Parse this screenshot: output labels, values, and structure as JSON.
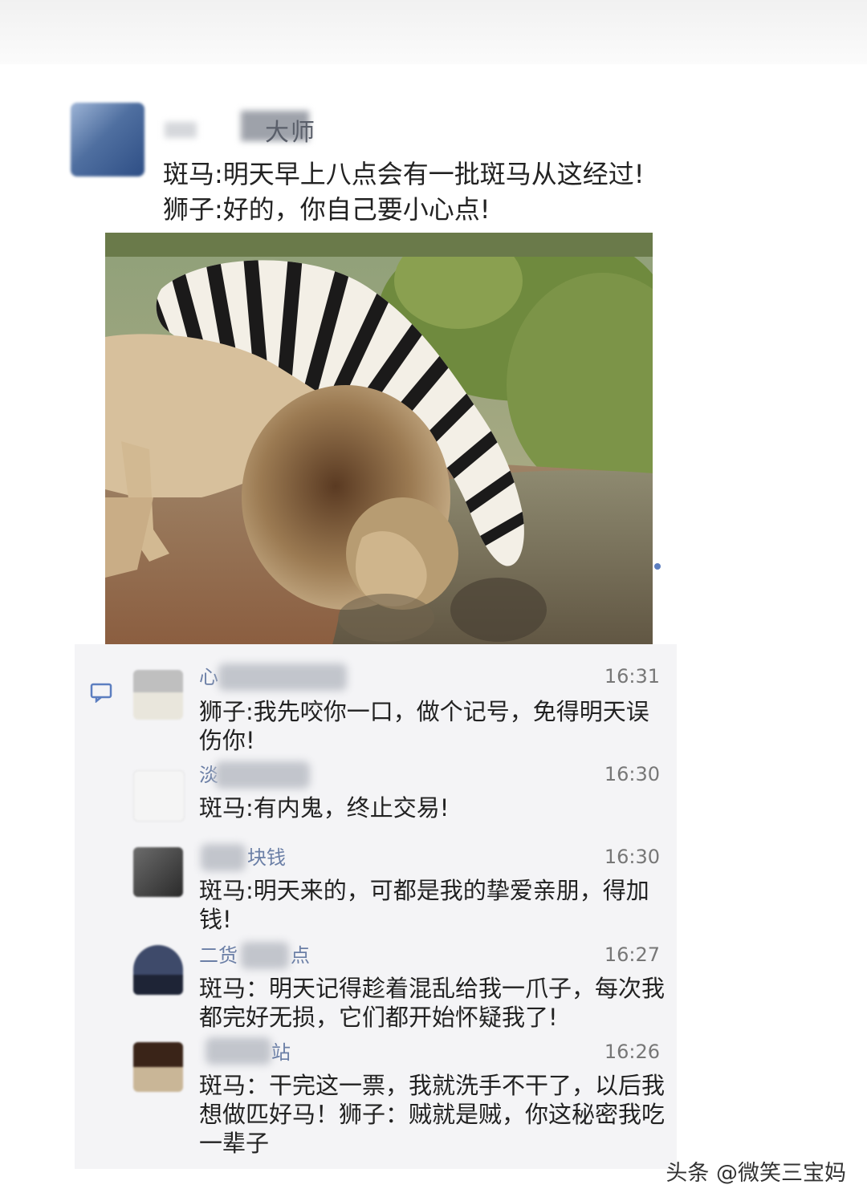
{
  "post": {
    "author_partial": "大师",
    "lines": [
      "斑马:明天早上八点会有一批斑马从这经过!",
      "狮子:好的，你自己要小心点!"
    ]
  },
  "comments": [
    {
      "name_partial": "心",
      "time": "16:31",
      "text": "狮子:我先咬你一口，做个记号，免得明天误伤你!"
    },
    {
      "name_partial": "淡",
      "time": "16:30",
      "text": "斑马:有内鬼，终止交易!"
    },
    {
      "name_partial": "块钱",
      "time": "16:30",
      "text": "斑马:明天来的，可都是我的挚爱亲朋，得加钱!"
    },
    {
      "name_partial": "二货",
      "name_suffix": "点",
      "time": "16:27",
      "text": "斑马：明天记得趁着混乱给我一爪子，每次我都完好无损，它们都开始怀疑我了!"
    },
    {
      "name_partial": "",
      "name_suffix": "站",
      "time": "16:26",
      "text": "斑马：干完这一票，我就洗手不干了，以后我想做匹好马！狮子：贼就是贼，你这秘密我吃一辈子"
    }
  ],
  "watermark": "头条 @微笑三宝妈",
  "icons": {
    "comment": "comment-bubble-icon"
  }
}
